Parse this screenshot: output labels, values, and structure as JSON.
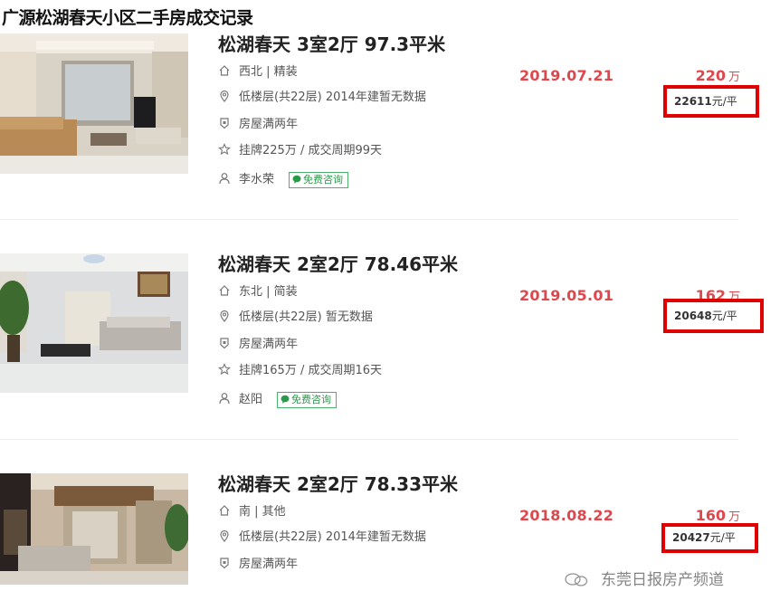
{
  "page_title": "广源松湖春天小区二手房成交记录",
  "consult_label": "免费咨询",
  "price_unit": "万",
  "listings": [
    {
      "title": "松湖春天 3室2厅 97.3平米",
      "orientation_decoration": "西北 | 精装",
      "floor_info": "低楼层(共22层) 2014年建暂无数据",
      "ownership": "房屋满两年",
      "listing_cycle": "挂牌225万 / 成交周期99天",
      "agent": "李水荣",
      "deal_date": "2019.07.21",
      "total_price": "220",
      "unit_price_value": "22611",
      "unit_price_suffix": "元/平"
    },
    {
      "title": "松湖春天 2室2厅 78.46平米",
      "orientation_decoration": "东北 | 简装",
      "floor_info": "低楼层(共22层) 暂无数据",
      "ownership": "房屋满两年",
      "listing_cycle": "挂牌165万 / 成交周期16天",
      "agent": "赵阳",
      "deal_date": "2019.05.01",
      "total_price": "162",
      "unit_price_value": "20648",
      "unit_price_suffix": "元/平"
    },
    {
      "title": "松湖春天 2室2厅 78.33平米",
      "orientation_decoration": "南 | 其他",
      "floor_info": "低楼层(共22层) 2014年建暂无数据",
      "ownership": "房屋满两年",
      "deal_date": "2018.08.22",
      "total_price": "160",
      "unit_price_value": "20427",
      "unit_price_suffix": "元/平"
    }
  ],
  "watermark_text": "东莞日报房产频道",
  "icons": [
    "house-icon",
    "location-pin-icon",
    "shield-icon",
    "star-icon",
    "user-icon",
    "chat-bubble-icon",
    "wechat-icon"
  ],
  "colors": {
    "accent_red": "#e0474c",
    "highlight_box": "#e00000",
    "consult_green": "#2a9a4a"
  }
}
